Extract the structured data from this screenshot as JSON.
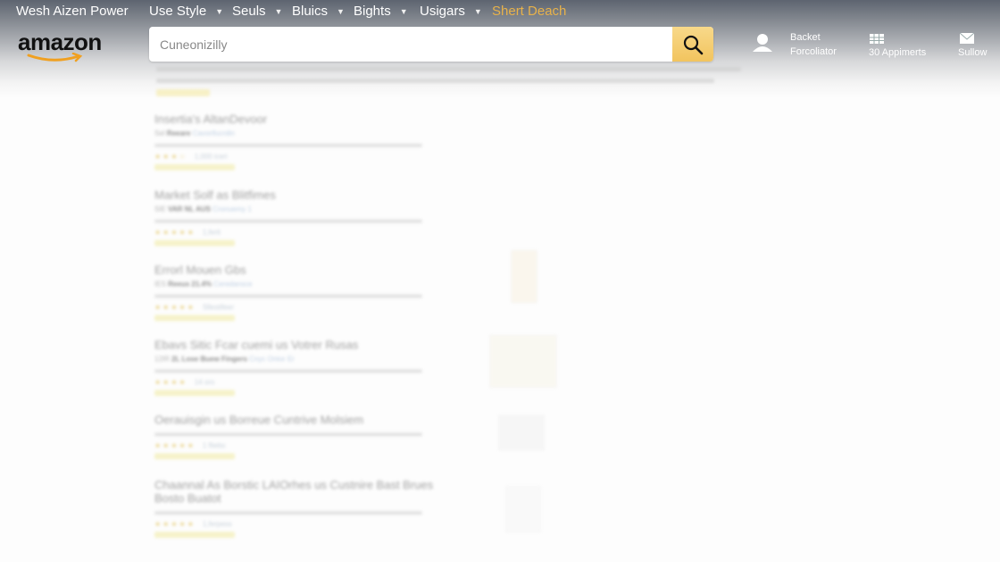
{
  "topnav": {
    "brand": "Wesh Aizen Power",
    "items": [
      {
        "label": "Use Style"
      },
      {
        "label": "Seuls"
      },
      {
        "label": "Bluics"
      },
      {
        "label": "Bights"
      },
      {
        "label": "Usigars"
      }
    ],
    "deal": "Shert Deach"
  },
  "logo": {
    "text": "amazon",
    "smile_color": "#f0a020"
  },
  "search": {
    "placeholder": "Cuneonizilly",
    "value": "",
    "button_icon": "search-icon",
    "button_color": "#f2c45e"
  },
  "account": {
    "line1": "Backet",
    "line2": "Forcoliator",
    "icon": "user-icon"
  },
  "orders": {
    "label": "30 Appimerts",
    "icon": "grid-icon"
  },
  "mail": {
    "label": "Sullow",
    "icon": "mail-icon"
  },
  "results": [
    {
      "title": "Insertia's AltanDevoor",
      "meta_pre": "Sel",
      "meta_bold": "Reeare",
      "meta_link": "Cavorifucrdin",
      "stars": "★★★☆",
      "count": "1,000 iceri"
    },
    {
      "title": "Market Solf as Blitfimes",
      "meta_pre": "SIE",
      "meta_bold": "VAR NL AUS",
      "meta_link": "Cronuemy 1",
      "stars": "★★★★★",
      "count": "1,ferit"
    },
    {
      "title": "Errorl Mouen Gbs",
      "meta_pre": "IES",
      "meta_bold": "Reeus 21.4%",
      "meta_link": "Ceredansce",
      "stars": "★★★★★",
      "count": "Sllestifeer"
    },
    {
      "title": "Ebavs Sitic Fcar cuemi us Votrer Rusas",
      "meta_pre": "12IR",
      "meta_bold": "2L Lose Buew Fingers",
      "meta_link": "Cnyc Ontor Er",
      "stars": "★★★★",
      "count": "14 oro"
    },
    {
      "title": "Oerauisgin us Borreue Cuntrive Molsiem",
      "meta_pre": "",
      "meta_bold": "",
      "meta_link": "",
      "stars": "★★★★★",
      "count": "1 fliebs"
    },
    {
      "title": "Chaannal As Borstic LAIOrhes us Custnire Bast Brues Bosto Buatot",
      "meta_pre": "",
      "meta_bold": "",
      "meta_link": "",
      "stars": "★★★★★",
      "count": "1,ferpess"
    }
  ]
}
